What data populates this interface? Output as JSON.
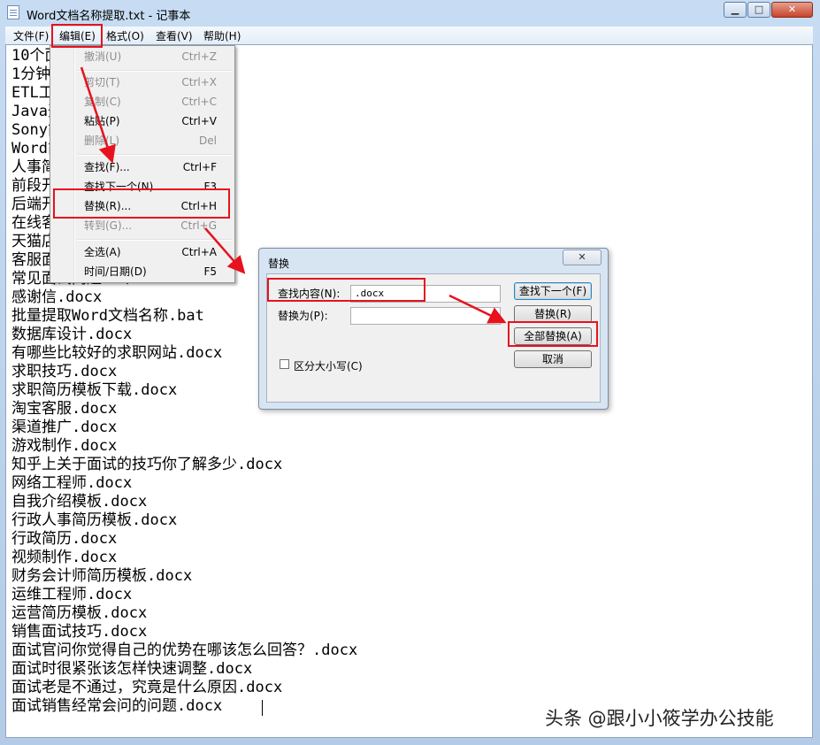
{
  "window": {
    "title": "Word文档名称提取.txt - 记事本",
    "controls": {
      "minimize": "▁",
      "maximize": "□",
      "close": "✕"
    }
  },
  "menubar": {
    "file": "文件(F)",
    "edit": "编辑(E)",
    "format": "格式(O)",
    "view": "查看(V)",
    "help": "帮助(H)"
  },
  "editor": {
    "lines": [
      "10个面试经常会问的问题.docx",
      "1分钟自我介绍.docx",
      "ETL工程师简历模板.docx",
      "Java开发工程师.docx",
      "Sony简历模板.docx",
      "Word简历模板.docx",
      "人事简历模板.docx",
      "前段开发工程师.docx",
      "后端开发工程师.docx",
      "在线客服简历模板.docx",
      "天猫店铺运营.docx",
      "客服面试技巧.docx",
      "常见面试问题10个.docx",
      "感谢信.docx",
      "批量提取Word文档名称.bat",
      "数据库设计.docx",
      "有哪些比较好的求职网站.docx",
      "求职技巧.docx",
      "求职简历模板下载.docx",
      "淘宝客服.docx",
      "渠道推广.docx",
      "游戏制作.docx",
      "知乎上关于面试的技巧你了解多少.docx",
      "网络工程师.docx",
      "自我介绍模板.docx",
      "行政人事简历模板.docx",
      "行政简历.docx",
      "视频制作.docx",
      "财务会计师简历模板.docx",
      "运维工程师.docx",
      "运营简历模板.docx",
      "销售面试技巧.docx",
      "面试官问你觉得自己的优势在哪该怎么回答？.docx",
      "面试时很紧张该怎样快速调整.docx",
      "面试老是不通过，究竟是什么原因.docx",
      "面试销售经常会问的问题.docx"
    ]
  },
  "edit_menu": {
    "undo": {
      "label": "撤消(U)",
      "shortcut": "Ctrl+Z"
    },
    "cut": {
      "label": "剪切(T)",
      "shortcut": "Ctrl+X"
    },
    "copy": {
      "label": "复制(C)",
      "shortcut": "Ctrl+C"
    },
    "paste": {
      "label": "粘贴(P)",
      "shortcut": "Ctrl+V"
    },
    "delete": {
      "label": "删除(L)",
      "shortcut": "Del"
    },
    "find": {
      "label": "查找(F)...",
      "shortcut": "Ctrl+F"
    },
    "find_next": {
      "label": "查找下一个(N)",
      "shortcut": "F3"
    },
    "replace": {
      "label": "替换(R)...",
      "shortcut": "Ctrl+H"
    },
    "goto": {
      "label": "转到(G)...",
      "shortcut": "Ctrl+G"
    },
    "select_all": {
      "label": "全选(A)",
      "shortcut": "Ctrl+A"
    },
    "time_date": {
      "label": "时间/日期(D)",
      "shortcut": "F5"
    }
  },
  "replace_dialog": {
    "title": "替换",
    "close": "✕",
    "find_label": "查找内容(N):",
    "find_value": ".docx",
    "replace_label": "替换为(P):",
    "replace_value": "",
    "find_next_button": "查找下一个(F)",
    "replace_button": "替换(R)",
    "replace_all_button": "全部替换(A)",
    "cancel_button": "取消",
    "match_case_label": "区分大小写(C)"
  },
  "watermark": "头条 @跟小小筱学办公技能",
  "colors": {
    "highlight": "#e6121e",
    "accent": "#3c7fb1"
  }
}
